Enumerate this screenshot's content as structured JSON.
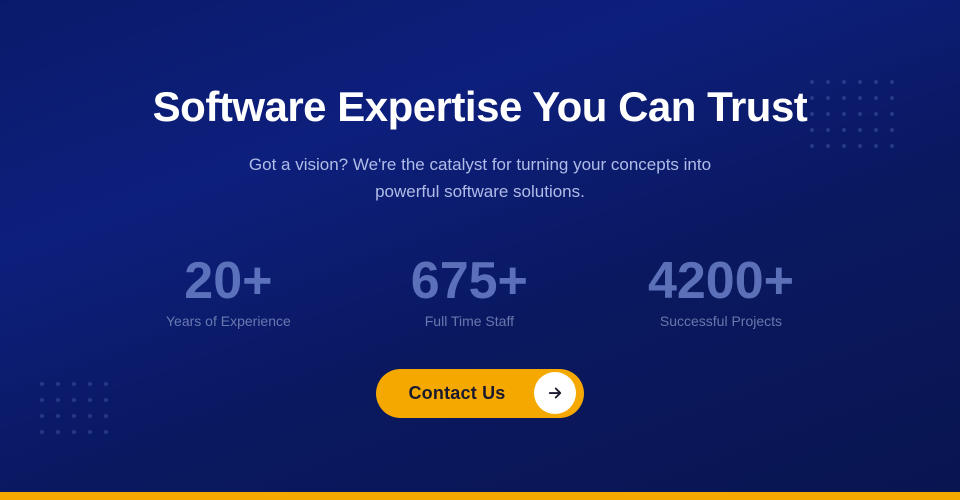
{
  "page": {
    "background": "#0a1860"
  },
  "hero": {
    "title": "Software Expertise You Can Trust",
    "subtitle": "Got a vision? We're the catalyst for turning your concepts into powerful software solutions."
  },
  "stats": [
    {
      "number": "20+",
      "label": "Years of Experience"
    },
    {
      "number": "675+",
      "label": "Full Time Staff"
    },
    {
      "number": "4200+",
      "label": "Successful Projects"
    }
  ],
  "cta": {
    "button_label": "Contact Us",
    "arrow_icon": "arrow-right-icon"
  }
}
